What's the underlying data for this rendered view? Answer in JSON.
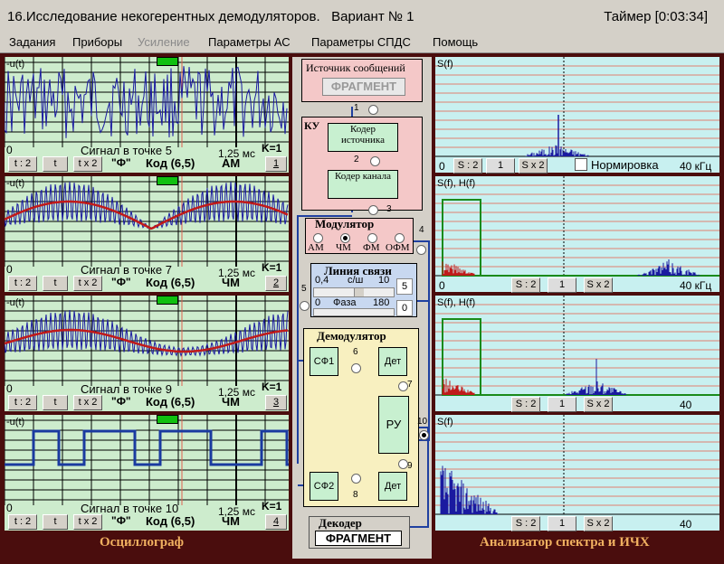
{
  "window": {
    "title": "16.Исследование некогерентных демодуляторов.   Вариант № 1",
    "timer": "Таймер [0:03:34]"
  },
  "menu": [
    {
      "label": "Задания",
      "enabled": true
    },
    {
      "label": "Приборы",
      "enabled": true
    },
    {
      "label": "Усиление",
      "enabled": false
    },
    {
      "label": "Параметры АС",
      "enabled": true
    },
    {
      "label": "Параметры СПДС",
      "enabled": true
    },
    {
      "label": "Помощь",
      "enabled": true
    }
  ],
  "oscilloscope": {
    "title": "Осциллограф",
    "channels": [
      {
        "ylabel": "-u(t)",
        "origin": "0",
        "signal": "Сигнал в точке 5",
        "time": "1,25 мс",
        "gain": "K=1",
        "btn_t2": "t : 2",
        "btn_t": "t",
        "btn_tx2": "t x 2",
        "phi": "\"Ф\"",
        "code": "Код (6,5)",
        "mod": "АМ",
        "num": "1"
      },
      {
        "ylabel": "-u(t)",
        "origin": "0",
        "signal": "Сигнал в точке 7",
        "time": "1,25 мс",
        "gain": "K=1",
        "btn_t2": "t : 2",
        "btn_t": "t",
        "btn_tx2": "t x 2",
        "phi": "\"Ф\"",
        "code": "Код (6,5)",
        "mod": "ЧМ",
        "num": "2"
      },
      {
        "ylabel": "-u(t)",
        "origin": "0",
        "signal": "Сигнал в точке 9",
        "time": "1,25 мс",
        "gain": "K=1",
        "btn_t2": "t : 2",
        "btn_t": "t",
        "btn_tx2": "t x 2",
        "phi": "\"Ф\"",
        "code": "Код (6,5)",
        "mod": "ЧМ",
        "num": "3"
      },
      {
        "ylabel": "-u(t)",
        "origin": "0",
        "signal": "Сигнал в точке 10",
        "time": "1,25 мс",
        "gain": "K=1",
        "btn_t2": "t : 2",
        "btn_t": "t",
        "btn_tx2": "t x 2",
        "phi": "\"Ф\"",
        "code": "Код (6,5)",
        "mod": "ЧМ",
        "num": "4"
      }
    ]
  },
  "scheme": {
    "source_title": "Источник сообщений",
    "source_value": "ФРАГМЕНТ",
    "ku": "КУ",
    "coder_source": "Кодер источника",
    "coder_channel": "Кодер канала",
    "modulator": "Модулятор",
    "mod_options": [
      "АМ",
      "ЧМ",
      "ФМ",
      "ОФМ"
    ],
    "mod_selected": "ЧМ",
    "line": "Линия связи",
    "snr_min": "0,4",
    "snr_label": "с/ш",
    "snr_max": "10",
    "snr_value": "5",
    "phase_min": "0",
    "phase_label": "Фаза",
    "phase_max": "180",
    "phase_value": "0",
    "demod": "Демодулятор",
    "sf1": "СФ1",
    "sf2": "СФ2",
    "det1": "Дет",
    "det2": "Дет",
    "ru": "РУ",
    "decoder": "Декодер",
    "decoder_value": "ФРАГМЕНТ",
    "points": [
      "1",
      "2",
      "3",
      "4",
      "5",
      "6",
      "7",
      "8",
      "9",
      "10"
    ]
  },
  "spectrum": {
    "title": "Анализатор спектра и ИЧХ",
    "panels": [
      {
        "ylabel": "S(f)",
        "origin": "0",
        "btn_div": "S : 2",
        "btn_mid": "1",
        "btn_mul": "S x 2",
        "norm": "Нормировка",
        "fmax": "40 кГц"
      },
      {
        "ylabel": "S(f), H(f)",
        "origin": "0",
        "btn_div": "S : 2",
        "btn_mid": "1",
        "btn_mul": "S x 2",
        "fmax": "40 кГц"
      },
      {
        "ylabel": "S(f), H(f)",
        "btn_div": "S : 2",
        "btn_mid": "1",
        "btn_mul": "S x 2",
        "fmax": "40"
      },
      {
        "ylabel": "S(f)",
        "btn_div": "S : 2",
        "btn_mid": "1",
        "btn_mul": "S x 2",
        "fmax": "40"
      }
    ]
  },
  "colors": {
    "frame": "#4a0d0d",
    "panel": "#cdeccd",
    "trace": "#1a1aa0",
    "envelope": "#c01a1a",
    "spectrum_bg": "#c8f0f0",
    "accent": "#f0b060"
  }
}
